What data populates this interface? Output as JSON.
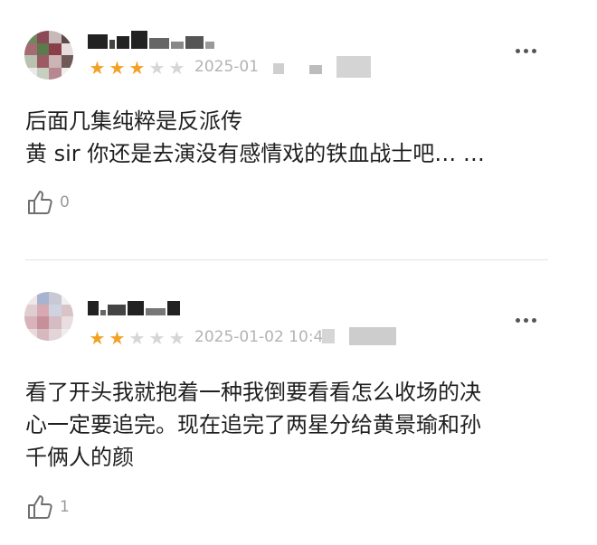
{
  "reviews": [
    {
      "rating": 3,
      "date": "2025-01",
      "lines": [
        "后面几集纯粹是反派传",
        "黄 sir 你还是去演没有感情戏的铁血战士吧… …"
      ],
      "likes": "0"
    },
    {
      "rating": 2,
      "date": "2025-01-02 10:4",
      "lines": [
        "看了开头我就抱着一种我倒要看看怎么收场的决",
        "心一定要追完。现在追完了两星分给黄景瑜和孙",
        "千俩人的颜"
      ],
      "likes": "1"
    }
  ],
  "icons": {
    "more": "more-dots-icon",
    "like": "thumbs-up-icon",
    "star": "star-icon"
  },
  "colors": {
    "star_on": "#f2a124",
    "star_off": "#d6d6d6",
    "meta_text": "#b3b3b3"
  }
}
